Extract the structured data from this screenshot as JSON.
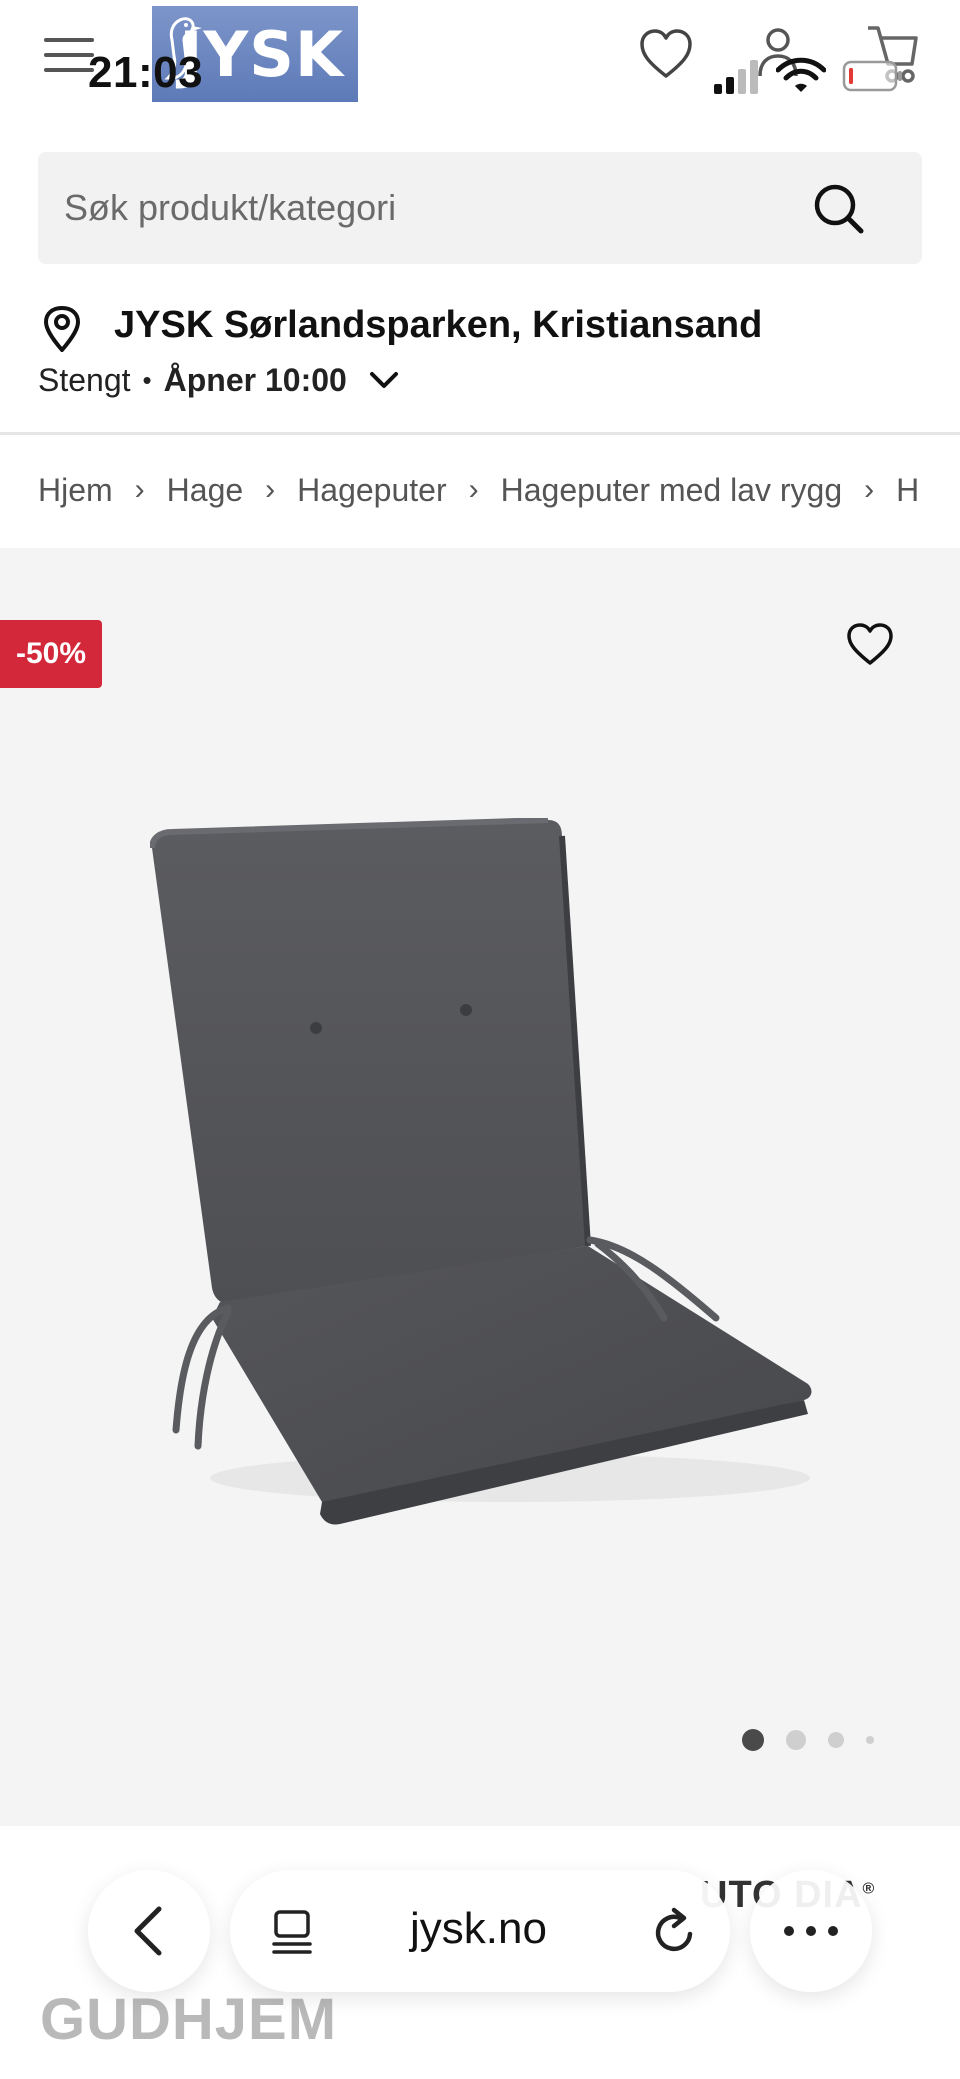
{
  "status_bar": {
    "time": "21:03"
  },
  "header": {
    "logo_text": "JYSK"
  },
  "search": {
    "placeholder": "Søk produkt/kategori"
  },
  "store": {
    "name": "JYSK Sørlandsparken, Kristiansand",
    "status": "Stengt",
    "separator": "•",
    "opens": "Åpner 10:00"
  },
  "breadcrumb": {
    "items": [
      "Hjem",
      "Hage",
      "Hageputer",
      "Hageputer med lav rygg",
      "H"
    ],
    "separator": "›"
  },
  "product": {
    "discount_badge": "-50%",
    "image_count": 4,
    "active_image": 1,
    "brand_fragment": "UTO DIA",
    "brand_reg_mark": "®",
    "title": "GUDHJEM"
  },
  "browser": {
    "url": "jysk.no"
  },
  "colors": {
    "discount": "#d3273a",
    "logo_bg": "#6b86c1",
    "search_bg": "#f2f2f2",
    "gallery_bg": "#f4f4f4"
  }
}
